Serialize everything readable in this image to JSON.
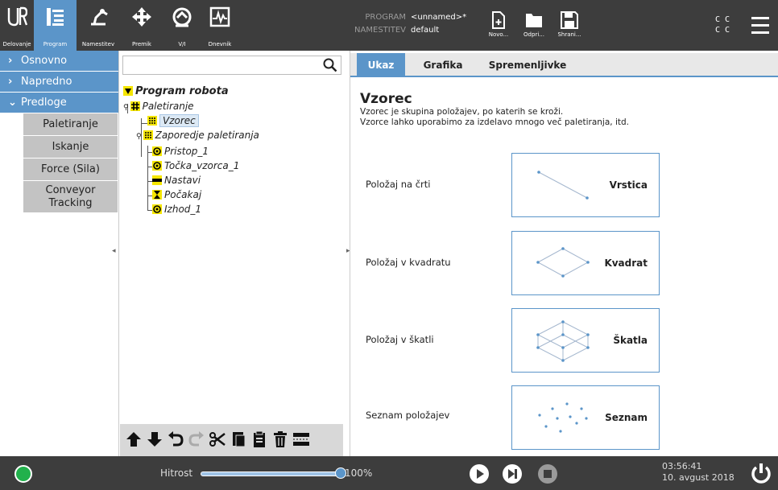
{
  "header": {
    "nav": [
      {
        "label": "Delovanje",
        "icon": "ur-logo-icon"
      },
      {
        "label": "Program",
        "icon": "program-icon"
      },
      {
        "label": "Namestitev",
        "icon": "installation-icon"
      },
      {
        "label": "Premik",
        "icon": "move-icon"
      },
      {
        "label": "V/I",
        "icon": "io-icon"
      },
      {
        "label": "Dnevnik",
        "icon": "log-icon"
      }
    ],
    "program_key": "PROGRAM",
    "program_value": "<unnamed>*",
    "installation_key": "NAMESTITEV",
    "installation_value": "default",
    "file_buttons": [
      {
        "label": "Novo...",
        "icon": "new-file-icon"
      },
      {
        "label": "Odpri...",
        "icon": "open-folder-icon"
      },
      {
        "label": "Shrani...",
        "icon": "save-icon"
      }
    ],
    "cc_line1": "C C",
    "cc_line2": "C C"
  },
  "leftnav": {
    "categories": [
      {
        "label": "Osnovno",
        "chev": "›"
      },
      {
        "label": "Napredno",
        "chev": "›"
      },
      {
        "label": "Predloge",
        "chev": "⌄"
      }
    ],
    "subitems": [
      "Paletiranje",
      "Iskanje",
      "Force (Sila)",
      "Conveyor Tracking"
    ]
  },
  "tree": {
    "search_value": "",
    "nodes": [
      {
        "label": "Program robota"
      },
      {
        "label": "Paletiranje"
      },
      {
        "label": "Vzorec"
      },
      {
        "label": "Zaporedje paletiranja"
      },
      {
        "label": "Pristop_1"
      },
      {
        "label": "Točka_vzorca_1"
      },
      {
        "label": "Nastavi"
      },
      {
        "label": "Počakaj"
      },
      {
        "label": "Izhod_1"
      }
    ]
  },
  "tabs": [
    "Ukaz",
    "Grafika",
    "Spremenljivke"
  ],
  "content": {
    "title": "Vzorec",
    "desc1": "Vzorec je skupina položajev, po katerih se kroži.",
    "desc2": "Vzorce lahko uporabimo za izdelavo mnogo več paletiranja, itd.",
    "patterns": [
      {
        "row_label": "Položaj na črti",
        "name": "Vrstica"
      },
      {
        "row_label": "Položaj v kvadratu",
        "name": "Kvadrat"
      },
      {
        "row_label": "Položaj v škatli",
        "name": "Škatla"
      },
      {
        "row_label": "Seznam položajev",
        "name": "Seznam"
      }
    ]
  },
  "footer": {
    "speed_label": "Hitrost",
    "speed_value": "100%",
    "speed_fraction": 1.0,
    "time": "03:56:41",
    "date": "10. avgust 2018"
  },
  "colors": {
    "accent": "#5b95c9",
    "header_bg": "#3d3d3d",
    "status_ok": "#22b14c",
    "node_yellow": "#f5e600"
  }
}
